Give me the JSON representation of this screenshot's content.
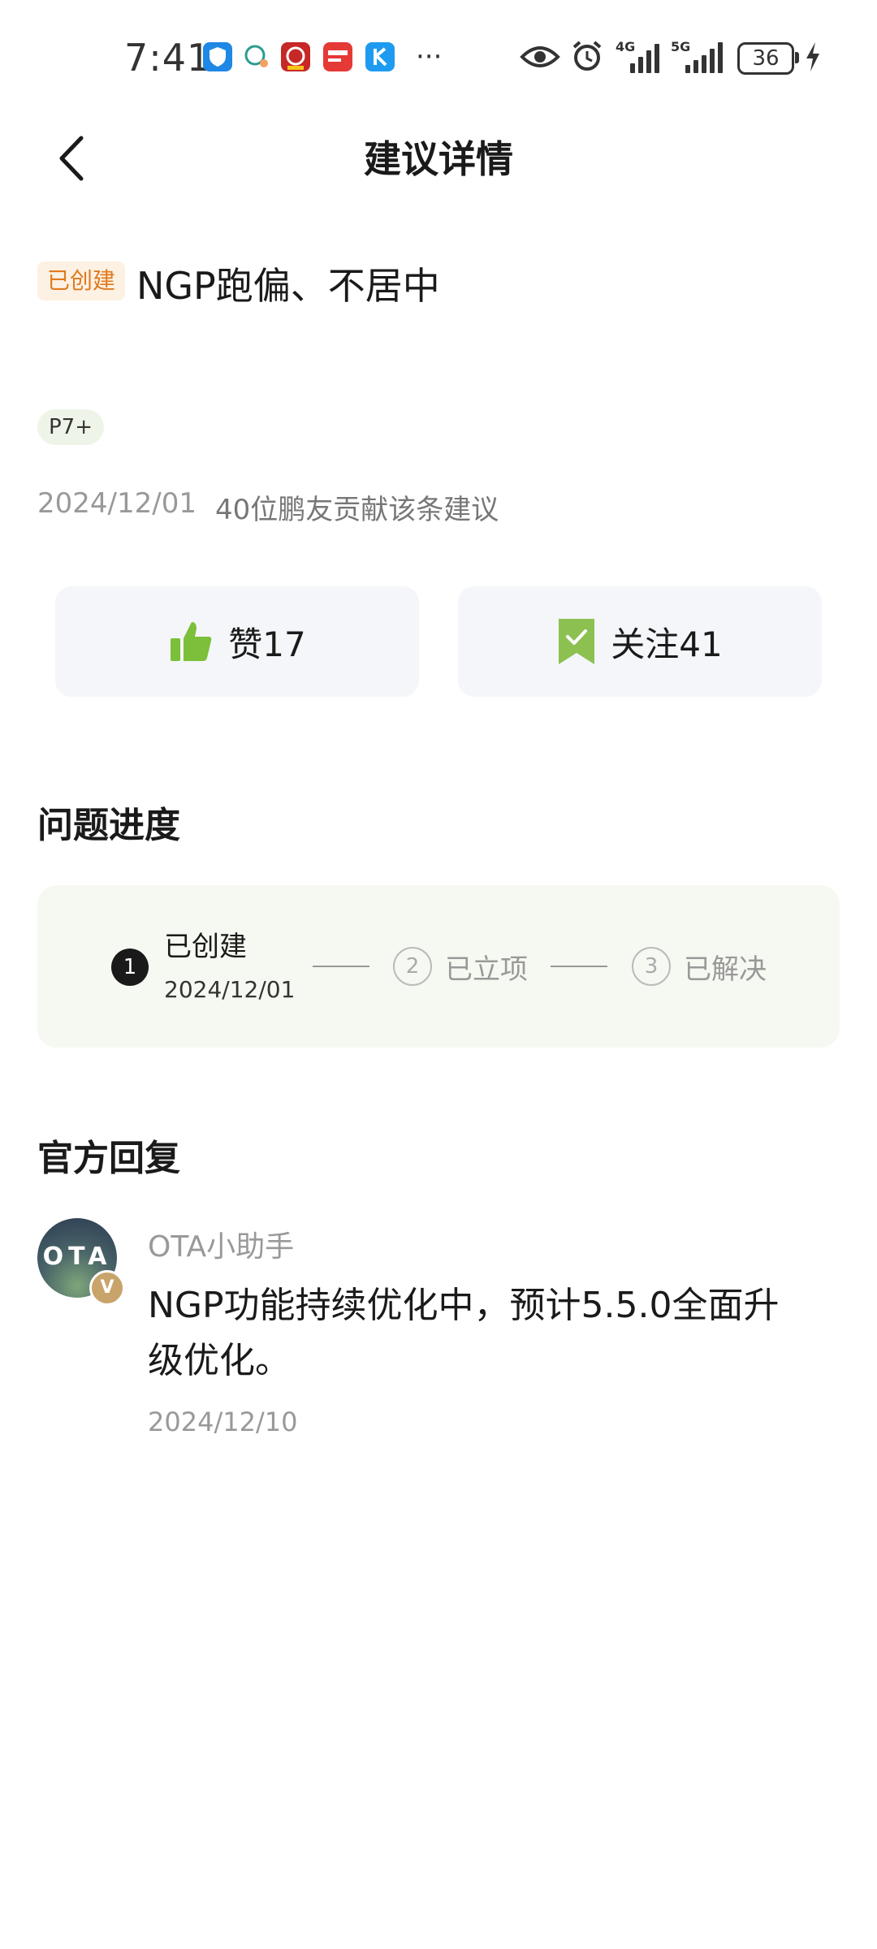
{
  "status_bar": {
    "time": "7:41",
    "more": "···",
    "network1": "4G",
    "network2": "5G",
    "battery": "36"
  },
  "header": {
    "title": "建议详情"
  },
  "suggestion": {
    "status_tag": "已创建",
    "title": "NGP跑偏、不居中",
    "model_tag": "P7+",
    "date": "2024/12/01",
    "contributors": "40位鹏友贡献该条建议"
  },
  "actions": {
    "like_label": "赞17",
    "follow_label": "关注41"
  },
  "progress": {
    "section_title": "问题进度",
    "steps": [
      {
        "num": "1",
        "label": "已创建",
        "date": "2024/12/01"
      },
      {
        "num": "2",
        "label": "已立项"
      },
      {
        "num": "3",
        "label": "已解决"
      }
    ]
  },
  "official_reply": {
    "section_title": "官方回复",
    "avatar_text": "OTA",
    "badge": "V",
    "author": "OTA小助手",
    "content": "NGP功能持续优化中，预计5.5.0全面升级优化。",
    "date": "2024/12/10"
  },
  "colors": {
    "accent_green": "#7cbf3a",
    "status_orange": "#e07a20",
    "progress_bg": "#f6f9f1"
  }
}
